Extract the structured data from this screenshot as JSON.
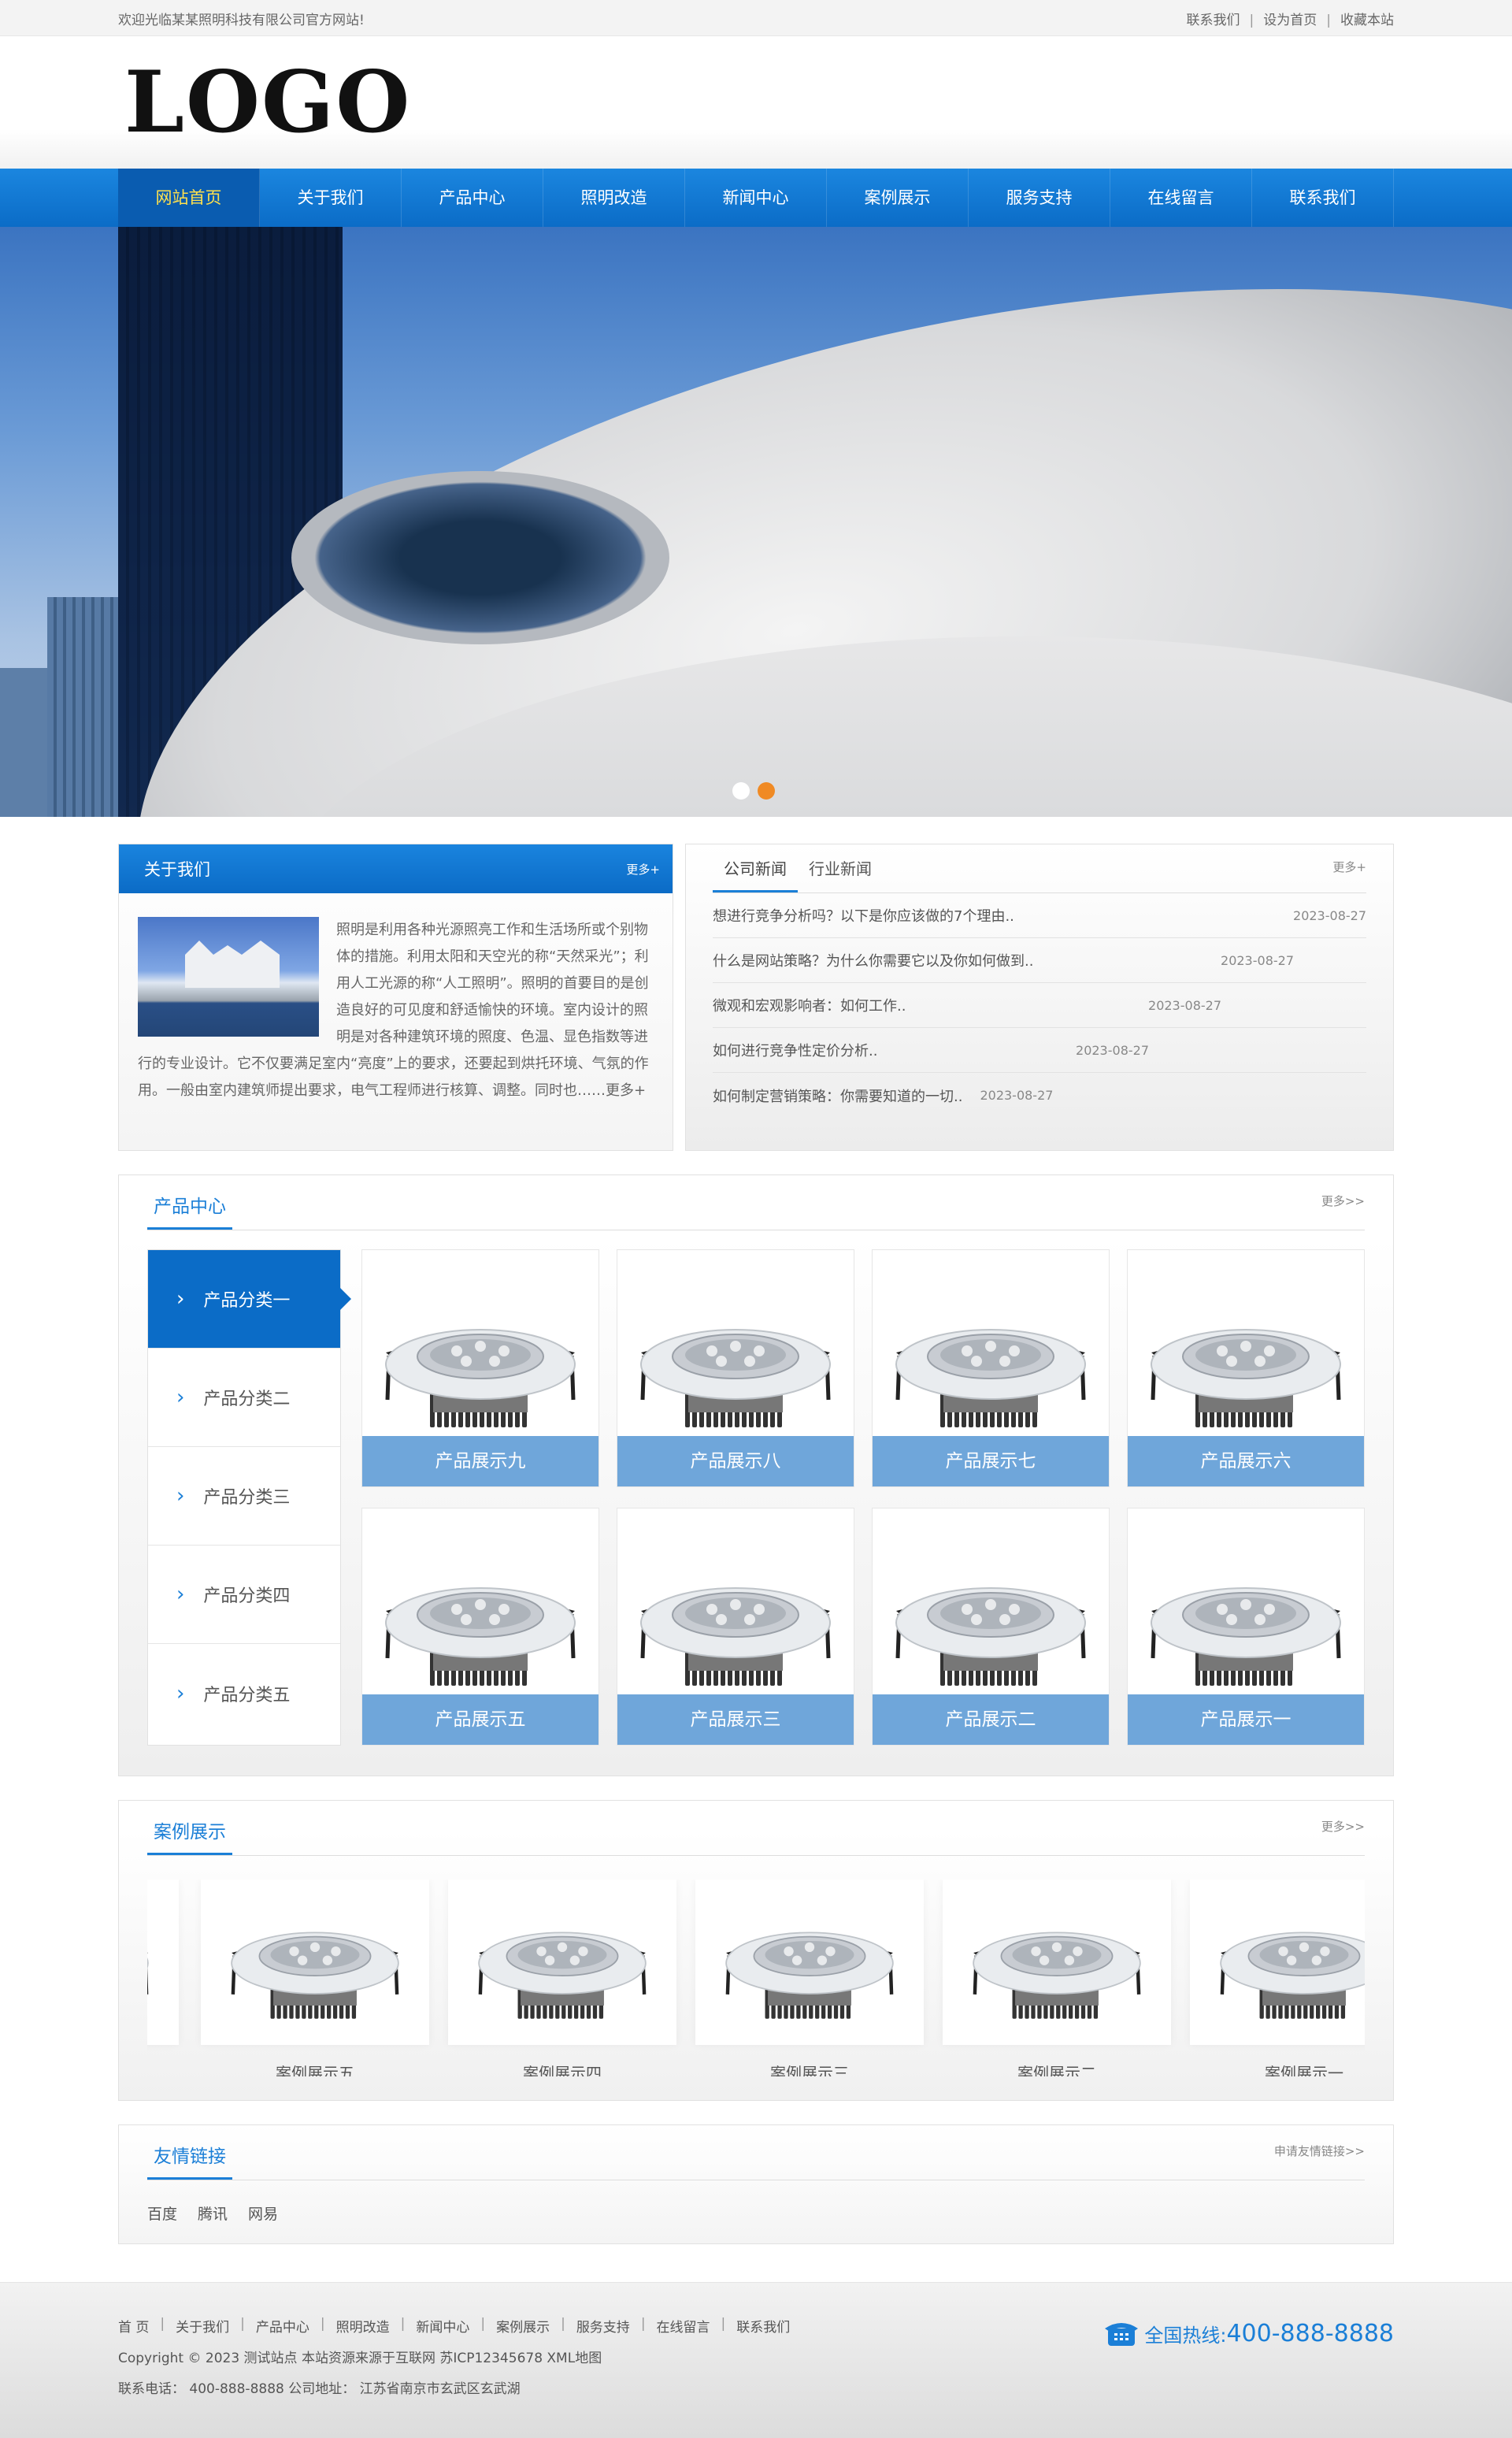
{
  "topbar": {
    "welcome": "欢迎光临某某照明科技有限公司官方网站!",
    "links": [
      "联系我们",
      "设为首页",
      "收藏本站"
    ]
  },
  "header": {
    "logo": "LOGO"
  },
  "nav": [
    "网站首页",
    "关于我们",
    "产品中心",
    "照明改造",
    "新闻中心",
    "案例展示",
    "服务支持",
    "在线留言",
    "联系我们"
  ],
  "banner": {
    "active_slide": 2,
    "slide_count": 2
  },
  "about": {
    "title": "关于我们",
    "more": "更多+",
    "text": "照明是利用各种光源照亮工作和生活场所或个别物体的措施。利用太阳和天空光的称“天然采光”；利用人工光源的称“人工照明”。照明的首要目的是创造良好的可见度和舒适愉快的环境。室内设计的照明是对各种建筑环境的照度、色温、显色指数等进行的专业设计。它不仅要满足室内“亮度”上的要求，还要起到烘托环境、气氛的作用。一般由室内建筑师提出要求，电气工程师进行核算、调整。同时也……",
    "text_more": "更多+"
  },
  "news": {
    "tabs": [
      "公司新闻",
      "行业新闻"
    ],
    "more": "更多+",
    "items": [
      {
        "title": "想进行竞争分析吗？以下是你应该做的7个理由..",
        "date": "2023-08-27"
      },
      {
        "title": "什么是网站策略？为什么你需要它以及你如何做到..",
        "date": "2023-08-27"
      },
      {
        "title": "微观和宏观影响者：如何工作..",
        "date": "2023-08-27"
      },
      {
        "title": "如何进行竞争性定价分析..",
        "date": "2023-08-27"
      },
      {
        "title": "如何制定营销策略：你需要知道的一切..",
        "date": "2023-08-27"
      }
    ]
  },
  "product": {
    "title": "产品中心",
    "more": "更多>>",
    "categories": [
      "产品分类一",
      "产品分类二",
      "产品分类三",
      "产品分类四",
      "产品分类五"
    ],
    "items": [
      "产品展示九",
      "产品展示八",
      "产品展示七",
      "产品展示六",
      "产品展示五",
      "产品展示三",
      "产品展示二",
      "产品展示一"
    ]
  },
  "cases": {
    "title": "案例展示",
    "more": "更多>>",
    "items": [
      "案例展示五",
      "案例展示四",
      "案例展示三",
      "案例展示二",
      "案例展示一"
    ]
  },
  "friend_links": {
    "title": "友情链接",
    "apply": "申请友情链接>>",
    "items": [
      "百度",
      "腾讯",
      "网易"
    ]
  },
  "footer": {
    "nav": [
      "首 页",
      "关于我们",
      "产品中心",
      "照明改造",
      "新闻中心",
      "案例展示",
      "服务支持",
      "在线留言",
      "联系我们"
    ],
    "copyright": "Copyright © 2023 测试站点 本站资源来源于互联网 苏ICP12345678 XML地图",
    "contact": "联系电话：  400-888-8888 公司地址：  江苏省南京市玄武区玄武湖",
    "hotline_label": "全国热线:",
    "hotline_number": "400-888-8888"
  },
  "colors": {
    "brand_blue": "#0b6cc7",
    "accent_orange": "#f08a24",
    "nav_active_text": "#ffe14d"
  }
}
